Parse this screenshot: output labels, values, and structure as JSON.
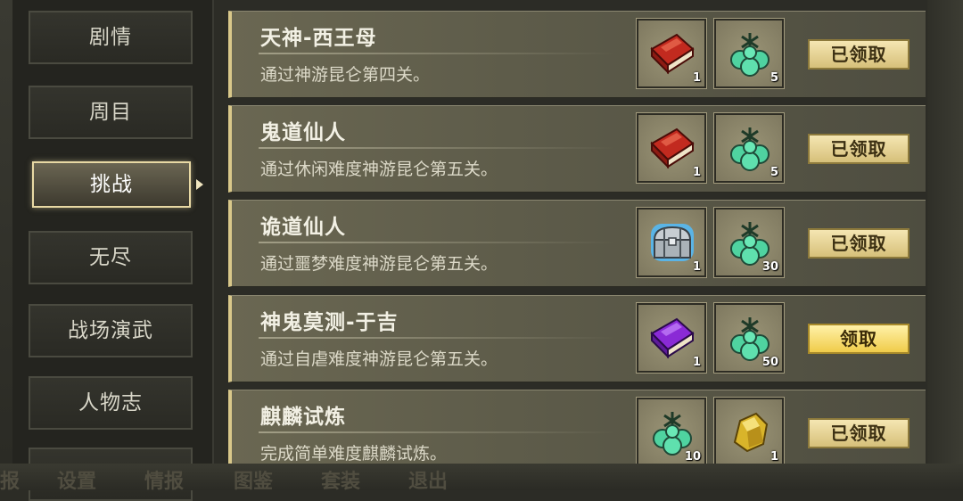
{
  "sidebar": {
    "items": [
      {
        "label": "剧情"
      },
      {
        "label": "周目"
      },
      {
        "label": "挑战"
      },
      {
        "label": "无尽"
      },
      {
        "label": "战场演武"
      },
      {
        "label": "人物志"
      }
    ],
    "active_index": 2
  },
  "achievements": [
    {
      "title": "天神-西王母",
      "desc": "通过神游昆仑第四关。",
      "rewards": [
        {
          "icon": "red-book-icon",
          "qty": "1"
        },
        {
          "icon": "jade-ball-icon",
          "qty": "5"
        }
      ],
      "button": "已领取"
    },
    {
      "title": "鬼道仙人",
      "desc": "通过休闲难度神游昆仑第五关。",
      "rewards": [
        {
          "icon": "red-book-icon",
          "qty": "1"
        },
        {
          "icon": "jade-ball-icon",
          "qty": "5"
        }
      ],
      "button": "已领取"
    },
    {
      "title": "诡道仙人",
      "desc": "通过噩梦难度神游昆仑第五关。",
      "rewards": [
        {
          "icon": "silver-chest-icon",
          "qty": "1"
        },
        {
          "icon": "jade-ball-icon",
          "qty": "30"
        }
      ],
      "button": "已领取"
    },
    {
      "title": "神鬼莫测-于吉",
      "desc": "通过自虐难度神游昆仑第五关。",
      "rewards": [
        {
          "icon": "purple-book-icon",
          "qty": "1"
        },
        {
          "icon": "jade-ball-icon",
          "qty": "50"
        }
      ],
      "button": "领取"
    },
    {
      "title": "麒麟试炼",
      "desc": "完成简单难度麒麟试炼。",
      "rewards": [
        {
          "icon": "jade-ball-icon",
          "qty": "10"
        },
        {
          "icon": "gold-nugget-icon",
          "qty": "1"
        }
      ],
      "button": "已领取"
    }
  ],
  "bottom_menu": [
    "报",
    "设置",
    "情报",
    "图鉴",
    "套装",
    "退出"
  ],
  "colors": {
    "accent_gold": "#d9c88a",
    "claimed_button": "#d6c07a",
    "claim_button": "#f0cc4a"
  }
}
